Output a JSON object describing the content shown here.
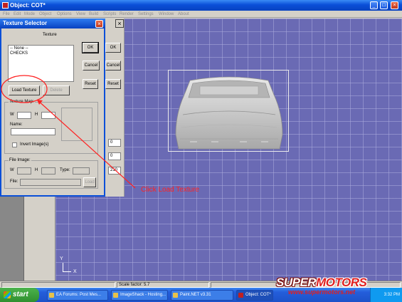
{
  "app": {
    "title": "Object: COT*",
    "minimize": "_",
    "maximize": "□",
    "close": "×"
  },
  "menu": [
    "File",
    "Edit",
    "Mode",
    "Object",
    "Options",
    "View",
    "Build",
    "Scripts",
    "Render",
    "Settings",
    "Window",
    "About"
  ],
  "background_panel": {
    "close": "×",
    "ok": "OK",
    "cancel": "Cancel",
    "reset": "Reset",
    "field1": "0",
    "field2": "0",
    "field3": "210"
  },
  "dialog": {
    "title": "Texture Selector",
    "close": "×",
    "texture_heading": "Texture",
    "list_items": [
      "-- None --",
      "CHECKS"
    ],
    "ok": "OK",
    "cancel": "Cancel",
    "reset": "Reset",
    "load_texture": "Load Texture",
    "delete": "Delete",
    "texture_map_label": "Texture Map:",
    "w_label": "W",
    "h_label": "H",
    "name_label": "Name:",
    "invert_label": "Invert Image(s)",
    "file_image_label": "File Image:",
    "fi_w_label": "W",
    "fi_h_label": "H",
    "type_label": "Type:",
    "file_label": "File:",
    "load": "Load"
  },
  "annotation": "Click Load Texture",
  "axis": {
    "y": "Y",
    "x": "X"
  },
  "status": {
    "scale": "Scale factor: 5.7"
  },
  "taskbar": {
    "start": "start",
    "tasks": [
      "EA Forums: Post Mes...",
      "ImageShack - Hosting...",
      "Paint.NET v3.31",
      "Object: COT*"
    ],
    "clock": "3:32 PM"
  },
  "watermark": {
    "logo_part1": "SUPER",
    "logo_part2": "MOTORS",
    "url": "www.supermotors.net"
  },
  "colors": {
    "title_bar": "#0a4fd8",
    "viewport": "#6a6ab4",
    "annotation": "#ff2222",
    "taskbar": "#245edb"
  }
}
